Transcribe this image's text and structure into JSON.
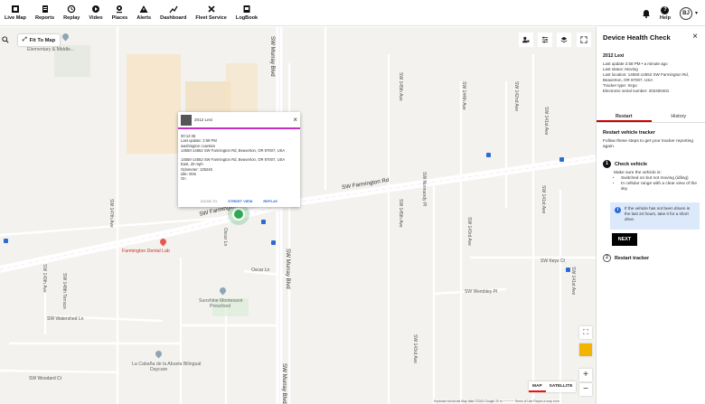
{
  "nav": {
    "items": [
      {
        "label": "Live Map",
        "icon": "live-map-icon"
      },
      {
        "label": "Reports",
        "icon": "reports-icon"
      },
      {
        "label": "Replay",
        "icon": "replay-icon"
      },
      {
        "label": "Video",
        "icon": "video-icon"
      },
      {
        "label": "Places",
        "icon": "places-icon"
      },
      {
        "label": "Alerts",
        "icon": "alerts-icon"
      },
      {
        "label": "Dashboard",
        "icon": "dashboard-icon"
      },
      {
        "label": "Fleet Service",
        "icon": "fleet-service-icon"
      },
      {
        "label": "LogBook",
        "icon": "logbook-icon"
      }
    ],
    "help_label": "Help",
    "avatar_initials": "BJ"
  },
  "map": {
    "fit_label": "Fit To Map",
    "streets": {
      "sw_murray_top": "SW Murray Blvd",
      "sw_farmington": "SW Farmington Rd",
      "sw_farmington_2": "SW Farmington Rd",
      "sw_142nd": "SW 142nd Ave",
      "sw_144th": "SW 144th Ave",
      "sw_145th_1": "SW 145th Ave",
      "sw_141st_1": "SW 141st Ave",
      "sw_141st_2": "SW 141st Ave",
      "sw_145th_2": "SW 145th Ave",
      "sw_143rd_1": "SW 143rd Ave",
      "sw_147th": "SW 147th Ave",
      "oscar_ln_1": "Oscar Ln",
      "oscar_ln_2": "Oscar Ln",
      "sw_murray_mid": "SW Murray Blvd",
      "sw_murray_bot": "SW Murray Blvd",
      "sw_149th": "SW 149th Ave",
      "sw_148th_terrace": "SW 148th Terrace",
      "sw_watershed": "SW Watershed Ln",
      "sw_woodard": "SW Woodard Ct",
      "sw_normandy": "SW Normandy Pl",
      "sw_keys": "SW Keys Ct",
      "sw_wembley": "SW Wembley Pl",
      "sw_143rd_2": "SW 143rd Ave",
      "sw_141st_3": "SW 141st Ave"
    },
    "pois": {
      "elementary": "Elementary & Middle...",
      "dental": "Farmington Dental Lab",
      "montessori_1": "Sunshine Montessori",
      "montessori_2": "Preschool",
      "daycare_1": "La Cabaña de la Abuela Bilingual",
      "daycare_2": "Daycare"
    },
    "map_type": {
      "map": "MAP",
      "satellite": "SATELLITE"
    },
    "attribution": "Keyboard shortcuts   Map data ©2024 Google   20 m ─────   Terms of Use   Report a map error",
    "colors": {
      "vehicle": "#33a853",
      "accent_line": "#c42fbf"
    }
  },
  "popup": {
    "title": "2012 Lexi",
    "lines_1": [
      "00:12:35",
      "Last update: 2:59 PM",
      "washington counties",
      "14550-14552 SW Farmington Rd, Beaverton, OR 97007, USA"
    ],
    "lines_2": [
      "14550-14552 SW Farmington Rd, Beaverton, OR 97007, USA",
      "East, 20 mph",
      "Odometer: 135245",
      "Idle: 00m",
      "On"
    ],
    "actions": {
      "zoom": "ZOOM TO",
      "street": "STREET VIEW",
      "replay": "REPLAY"
    }
  },
  "panel": {
    "title": "Device Health Check",
    "vehicle": "2012 Lexi",
    "last_update": "Last update 2:58 PM • a minute ago",
    "last_status": "Last status: Moving",
    "last_location": "Last location: 14550-14552 SW Farmington Rd, Beaverton, OR 97007, USA",
    "tracker_type": "Tracker type: Xirgo",
    "serial": "Electronic serial number: 202400401",
    "tabs": {
      "restart": "Restart",
      "history": "History"
    },
    "restart_heading": "Restart vehicle tracker",
    "restart_desc": "Follow these steps to get your tracker reporting again.",
    "step1": {
      "num": "1",
      "title": "Check vehicle",
      "intro": "Make sure the vehicle is:",
      "bullets": [
        "Switched on but not moving (idling)",
        "In cellular range with a clear view of the sky"
      ]
    },
    "notice": "If the vehicle has not been driven in the last 24 hours, take it for a short drive.",
    "next_label": "NEXT",
    "step2": {
      "num": "2",
      "title": "Restart tracker"
    }
  }
}
